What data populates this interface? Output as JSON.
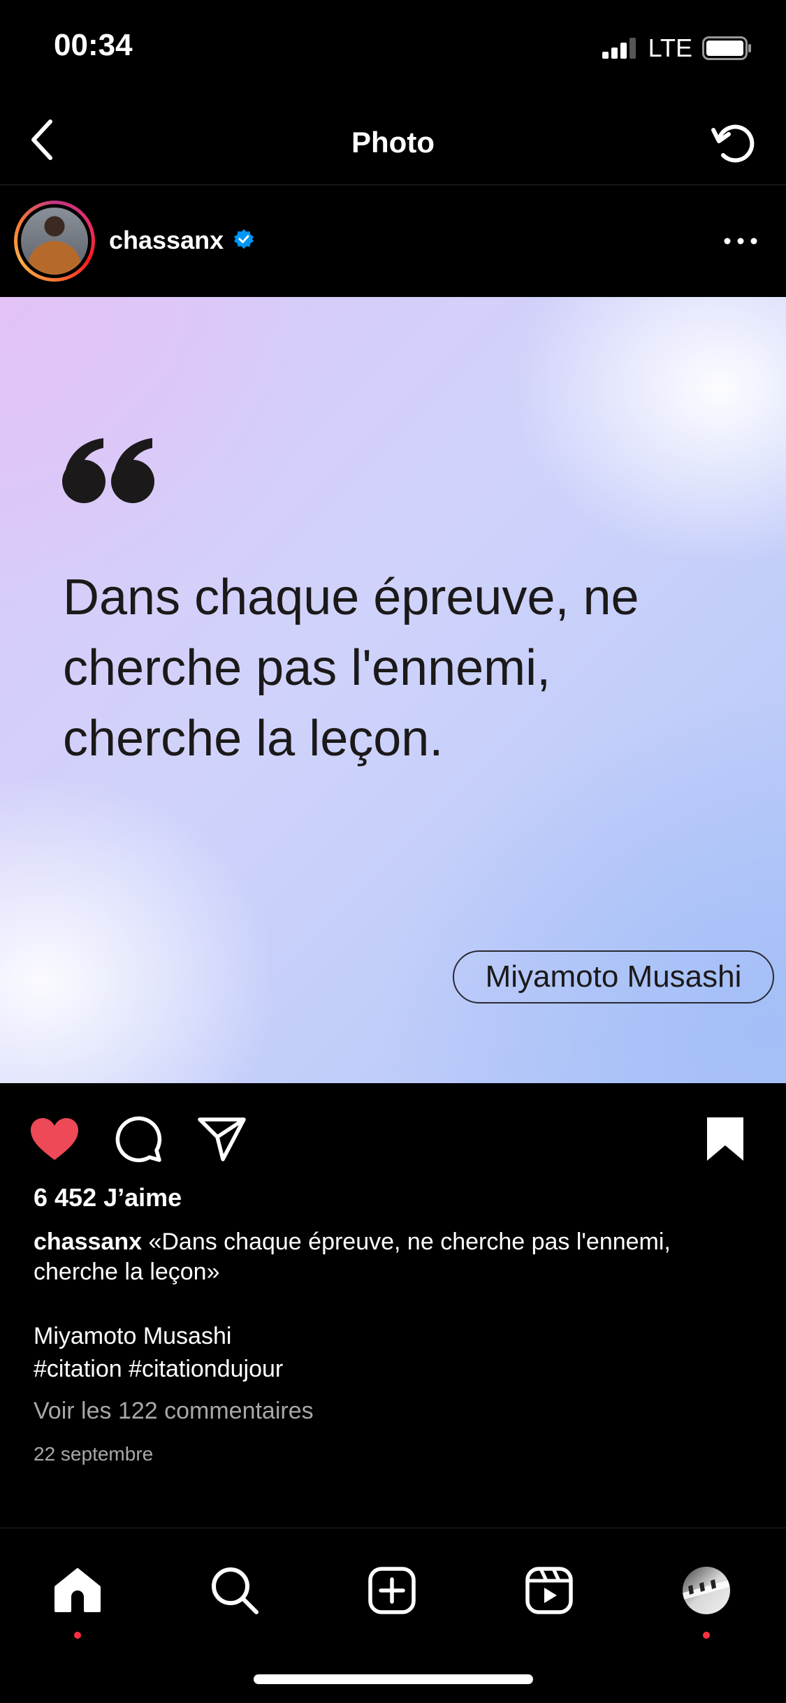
{
  "status_bar": {
    "time": "00:34",
    "network": "LTE"
  },
  "header": {
    "title": "Photo"
  },
  "post": {
    "username": "chassanx",
    "quote": "Dans chaque épreuve, ne cherche pas l'ennemi, cherche la leçon.",
    "author": "Miyamoto Musashi",
    "likes": "6 452 J’aime",
    "caption_text": " «Dans chaque épreuve, ne cherche pas l'ennemi, cherche la leçon»",
    "caption_author": "Miyamoto Musashi",
    "hashtags": "#citation #citationdujour",
    "comments_link": "Voir les 122 commentaires",
    "date": "22 septembre",
    "liked": true,
    "saved": true
  },
  "colors": {
    "like_red": "#ed4956",
    "verified_blue": "#0095f6",
    "notification_dot": "#ff3040"
  },
  "icons": {
    "header": [
      "back-icon",
      "refresh-icon"
    ],
    "actions": [
      "heart-icon",
      "comment-icon",
      "share-icon",
      "bookmark-icon"
    ],
    "tabs": [
      "home-icon",
      "search-icon",
      "create-icon",
      "reels-icon",
      "profile-avatar"
    ]
  }
}
